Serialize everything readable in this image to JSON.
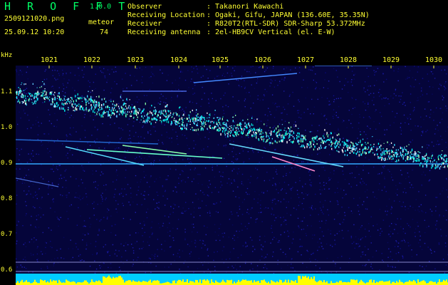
{
  "header": {
    "app_name": "H R O F F T",
    "version": "1.0.0",
    "filename": "2509121020.png",
    "datetime": "25.09.12 10:20",
    "meteor_label": "meteor",
    "meteor_count": "74",
    "info_rows": [
      {
        "key": "Observer",
        "value": "Takanori Kawachi"
      },
      {
        "key": "Receiving Location",
        "value": "Ogaki, Gifu, JAPAN (136.60E, 35.35N)"
      },
      {
        "key": "Receiver",
        "value": "R820T2(RTL-SDR) SDR-Sharp 53.372MHz"
      },
      {
        "key": "Receiving antenna",
        "value": "2el-HB9CV Vertical (el. E-W)"
      }
    ]
  },
  "axis": {
    "unit": "kHz",
    "minute_ticks": [
      "1021",
      "1022",
      "1023",
      "1024",
      "1025",
      "1026",
      "1027",
      "1028",
      "1029",
      "1030"
    ],
    "freq_ticks": [
      "1.1",
      "1.0",
      "0.9",
      "0.8",
      "0.7",
      "0.6"
    ]
  },
  "colors": {
    "background": "#000000",
    "noise": "#0a0a6a",
    "signal": "#00ffff",
    "strong": "#ffff00",
    "text": "#ffff33",
    "title": "#00ff66"
  }
}
